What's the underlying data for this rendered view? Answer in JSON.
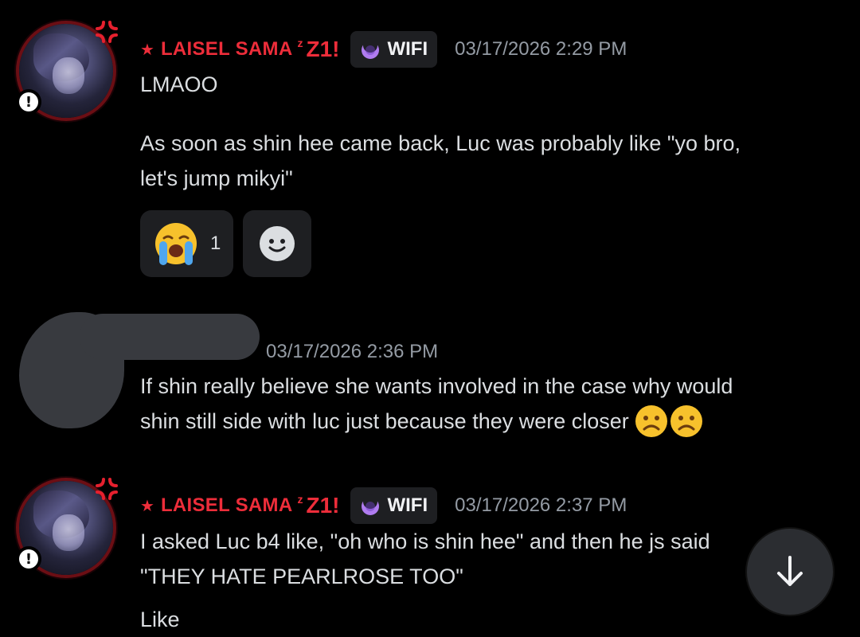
{
  "messages": [
    {
      "author": "LAISEL SAMA",
      "author_prefix": "★",
      "author_suffix": "z",
      "author_deco": "Z1!",
      "tag": "WIFI",
      "timestamp": "03/17/2026 2:29 PM",
      "lines": [
        "LMAOO",
        "As soon as shin hee came back, Luc was probably like \"yo bro,",
        "let's jump mikyi\""
      ],
      "reactions": [
        {
          "icon": "loudly-crying-face-icon",
          "count": "1"
        }
      ]
    },
    {
      "author": "",
      "timestamp": "03/17/2026 2:36 PM",
      "lines": [
        "If shin really believe she wants involved in the case why would",
        "shin still side with luc just because they were closer"
      ]
    },
    {
      "author": "LAISEL SAMA",
      "author_prefix": "★",
      "author_suffix": "z",
      "author_deco": "Z1!",
      "tag": "WIFI",
      "timestamp": "03/17/2026 2:37 PM",
      "lines": [
        "I asked Luc b4 like, \"oh who is shin hee\" and then he js said",
        "\"THEY HATE PEARLROSE TOO\"",
        "Like"
      ]
    }
  ],
  "colors": {
    "background": "#000000",
    "username": "#ed2d3a",
    "timestamp": "#949ba4",
    "text": "#dbdee1",
    "reaction_bg": "#1e1f22"
  },
  "icons": {
    "add_reaction": "smiley-face-icon",
    "scroll_down": "arrow-down-icon",
    "status": "exclamation-icon"
  }
}
